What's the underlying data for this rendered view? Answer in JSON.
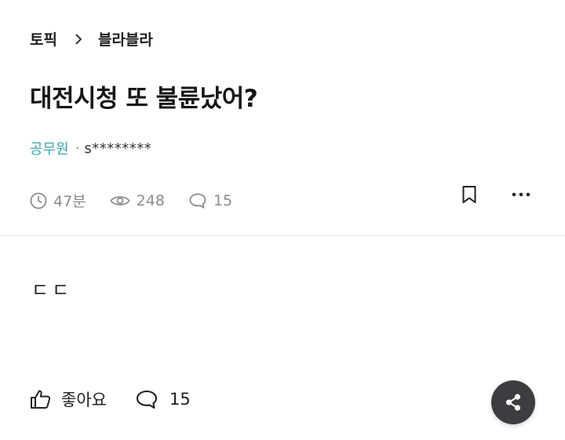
{
  "breadcrumb": {
    "topic": "토픽",
    "board": "블라블라"
  },
  "post": {
    "title": "대전시청 또 불륜났어?",
    "company": "공무원",
    "separator": "·",
    "author": "s********",
    "body": "ㄷㄷ"
  },
  "meta": {
    "time": "47분",
    "views": "248",
    "comments": "15"
  },
  "footer": {
    "like_label": "좋아요",
    "comment_count": "15"
  },
  "colors": {
    "company": "#3ba5ad",
    "meta": "#8c8c8c",
    "share_bg": "#3d3d3f"
  }
}
